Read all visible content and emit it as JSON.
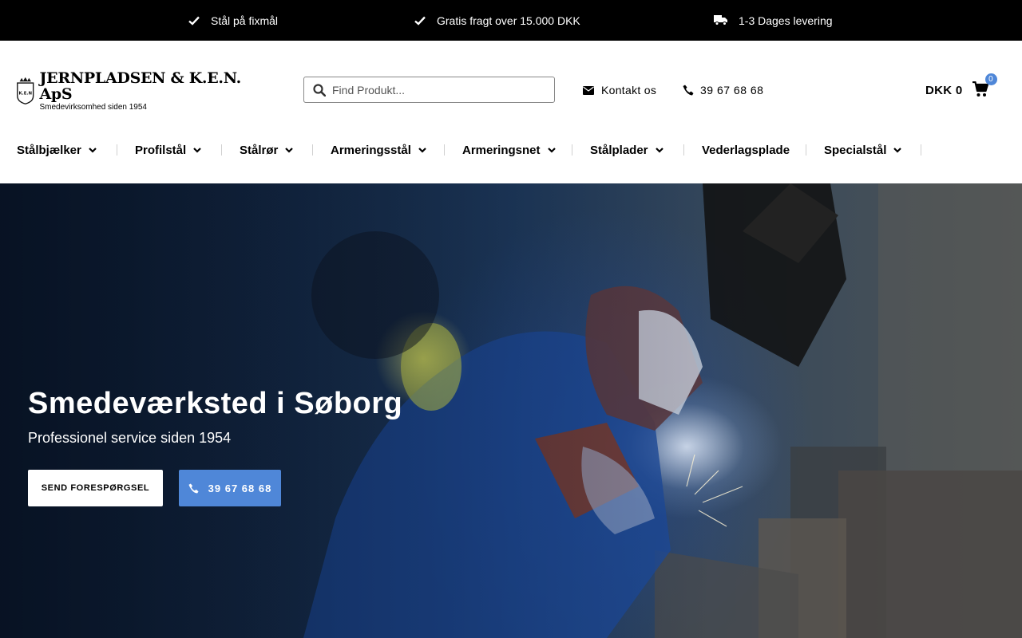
{
  "topbar": {
    "usps": [
      {
        "icon": "check-icon",
        "text": "Stål på fixmål"
      },
      {
        "icon": "check-icon",
        "text": "Gratis fragt over 15.000 DKK"
      },
      {
        "icon": "truck-icon",
        "text": "1-3 Dages levering"
      }
    ]
  },
  "header": {
    "logo": {
      "brand": "JERNPLADSEN & K.E.N. ApS",
      "tagline": "Smedevirksomhed siden 1954",
      "crest_text": "K.E.N"
    },
    "search": {
      "placeholder": "Find Produkt..."
    },
    "contact_label": "Kontakt os",
    "phone": "39 67 68 68",
    "cart": {
      "total": "DKK 0",
      "count": "0"
    }
  },
  "nav": {
    "items": [
      {
        "label": "Stålbjælker",
        "has_dropdown": true
      },
      {
        "label": "Profilstål",
        "has_dropdown": true
      },
      {
        "label": "Stålrør",
        "has_dropdown": true
      },
      {
        "label": "Armeringsstål",
        "has_dropdown": true
      },
      {
        "label": "Armeringsnet",
        "has_dropdown": true
      },
      {
        "label": "Stålplader",
        "has_dropdown": true
      },
      {
        "label": "Vederlagsplade",
        "has_dropdown": false
      },
      {
        "label": "Specialstål",
        "has_dropdown": true
      }
    ]
  },
  "hero": {
    "title": "Smedeværksted i Søborg",
    "subtitle": "Professionel service siden 1954",
    "cta_primary": "SEND FORESPØRGSEL",
    "cta_phone": "39 67 68 68"
  },
  "colors": {
    "accent": "#4f87d8",
    "topbar": "#000000"
  }
}
